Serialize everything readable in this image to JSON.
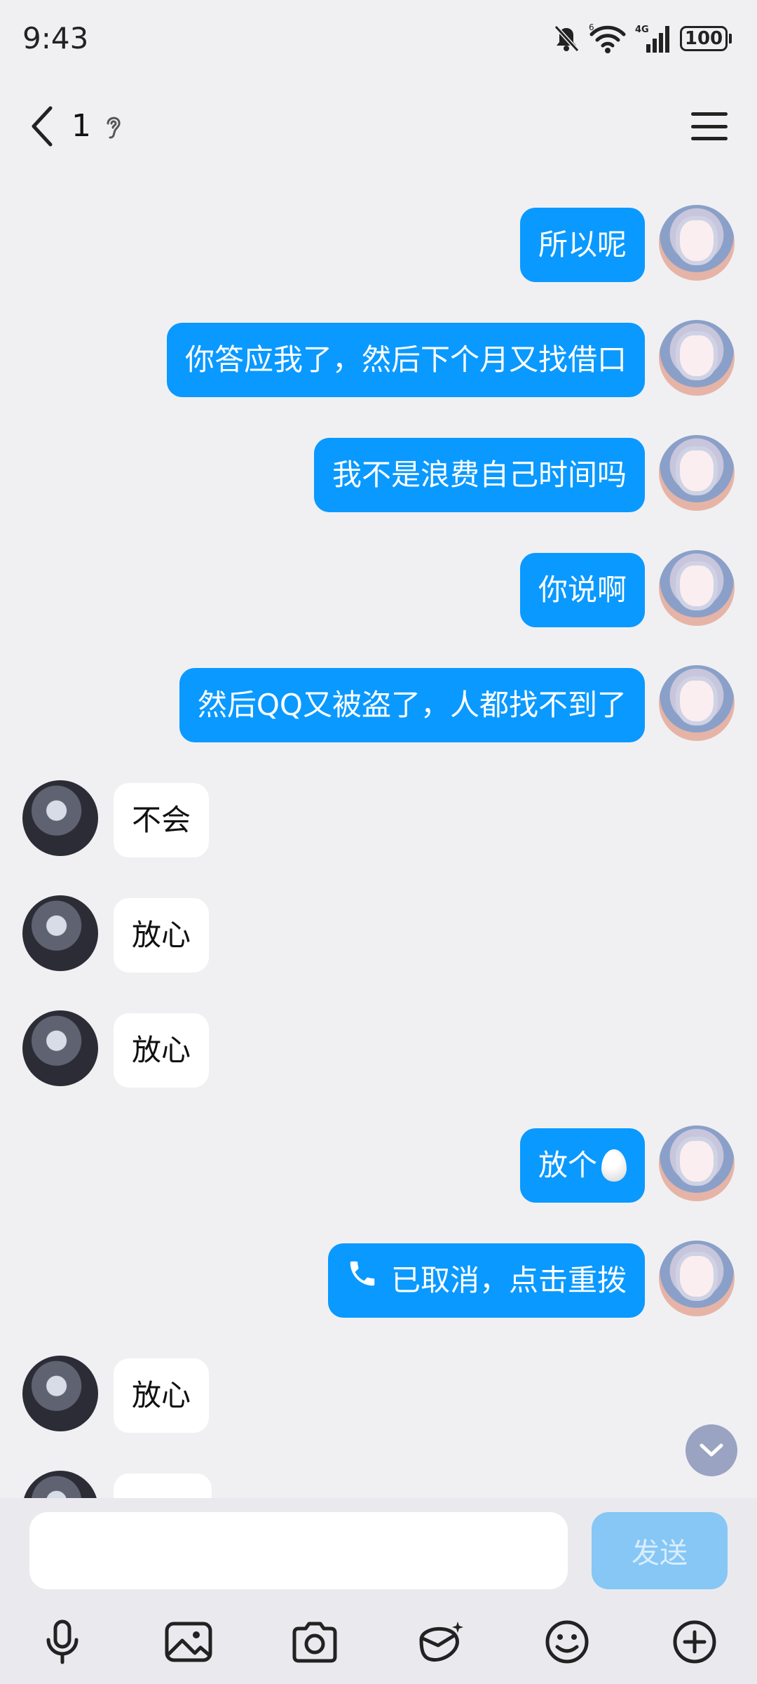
{
  "status_bar": {
    "time": "9:43",
    "network_badge": "4G",
    "sim_badge": "6",
    "battery": "100"
  },
  "header": {
    "title": "1"
  },
  "messages": [
    {
      "side": "right",
      "text": "所以呢"
    },
    {
      "side": "right",
      "text": "你答应我了，然后下个月又找借口"
    },
    {
      "side": "right",
      "text": "我不是浪费自己时间吗"
    },
    {
      "side": "right",
      "text": "你说啊"
    },
    {
      "side": "right",
      "text": "然后QQ又被盗了，人都找不到了"
    },
    {
      "side": "left",
      "text": "不会"
    },
    {
      "side": "left",
      "text": "放心"
    },
    {
      "side": "left",
      "text": "放心"
    },
    {
      "side": "right",
      "text": "放个",
      "emoji": "egg"
    },
    {
      "side": "right",
      "text": "已取消，点击重拨",
      "icon": "phone-icon"
    },
    {
      "side": "left",
      "text": "放心"
    }
  ],
  "composer": {
    "input_value": "",
    "send_label": "发送"
  },
  "toolbar": {
    "items": [
      "microphone-icon",
      "image-icon",
      "camera-icon",
      "red-packet-icon",
      "emoji-icon",
      "plus-icon"
    ]
  },
  "colors": {
    "self_bubble": "#0a99ff",
    "other_bubble": "#ffffff",
    "background": "#f0f0f3",
    "send_button": "#86c7f6"
  }
}
